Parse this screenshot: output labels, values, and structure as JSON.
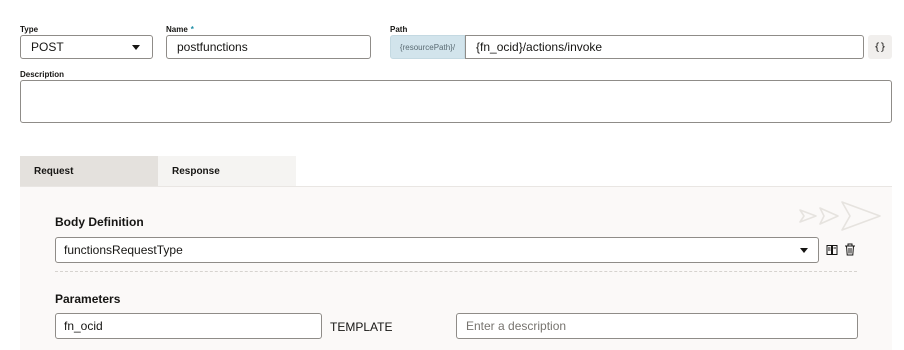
{
  "form": {
    "type_label": "Type",
    "type_value": "POST",
    "name_label": "Name",
    "name_required": "*",
    "name_value": "postfunctions",
    "path_label": "Path",
    "path_prefix": "{resourcePath}/",
    "path_value": "{fn_ocid}/actions/invoke",
    "path_button_icon": "{}",
    "description_label": "Description",
    "description_value": ""
  },
  "tabs": [
    {
      "label": "Request",
      "active": true
    },
    {
      "label": "Response",
      "active": false
    }
  ],
  "request": {
    "body_definition_title": "Body Definition",
    "body_type_value": "functionsRequestType",
    "parameters_title": "Parameters",
    "param_name_value": "fn_ocid",
    "param_type": "TEMPLATE",
    "param_description_placeholder": "Enter a description"
  },
  "icons": {
    "dropdown": "caret-down-icon",
    "schema": "schema-book-icon",
    "delete": "trash-icon",
    "watermark": "send-arrows-icon"
  }
}
